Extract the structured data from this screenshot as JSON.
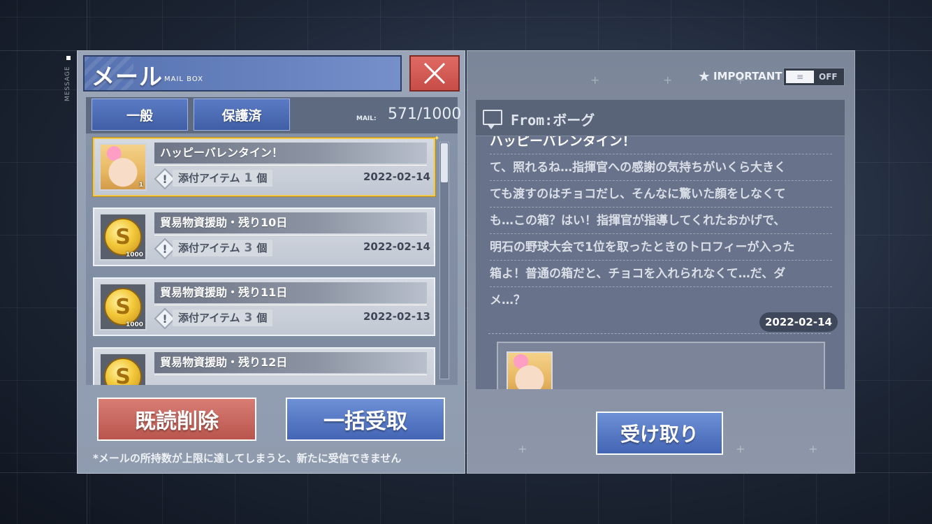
{
  "side_label": "MESSAGE",
  "header": {
    "title": "メール",
    "subtitle": "MAIL BOX"
  },
  "tabs": [
    {
      "label": "一般"
    },
    {
      "label": "保護済"
    }
  ],
  "mail_count": {
    "label": "MAIL:",
    "value": "571/1000"
  },
  "mail_list": [
    {
      "title": "ハッピーバレンタイン！",
      "attach_label": "添付アイテム",
      "attach_count": "1",
      "attach_unit": "個",
      "date": "2022-02-14",
      "thumb": "character-avatar",
      "thumb_count": "1",
      "selected": true
    },
    {
      "title": "貿易物資援助・残り10日",
      "attach_label": "添付アイテム",
      "attach_count": "3",
      "attach_unit": "個",
      "date": "2022-02-14",
      "thumb": "gold-coin-icon",
      "thumb_count": "1000"
    },
    {
      "title": "貿易物資援助・残り11日",
      "attach_label": "添付アイテム",
      "attach_count": "3",
      "attach_unit": "個",
      "date": "2022-02-13",
      "thumb": "gold-coin-icon",
      "thumb_count": "1000"
    },
    {
      "title": "貿易物資援助・残り12日",
      "thumb": "gold-coin-icon"
    }
  ],
  "buttons": {
    "delete_read": "既読削除",
    "receive_all": "一括受取",
    "receive": "受け取り"
  },
  "footer_note": "*メールの所持数が上限に達してしまうと、新たに受信できません",
  "important": {
    "label": "IMPORTANT",
    "toggle_state": "OFF",
    "knob_glyph": "≡"
  },
  "message": {
    "from": "From:ボーグ",
    "subject": "ハッピーバレンタイン！",
    "lines": [
      "て、照れるね…指揮官への感謝の気持ちがいくら大きく",
      "ても渡すのはチョコだし、そんなに驚いた顔をしなくて",
      "も…この箱？はい！指揮官が指導してくれたおかげで、",
      "明石の野球大会で1位を取ったときのトロフィーが入った",
      "箱よ！普通の箱だと、チョコを入れられなくて…だ、ダ",
      "メ…？"
    ],
    "date": "2022-02-14"
  }
}
